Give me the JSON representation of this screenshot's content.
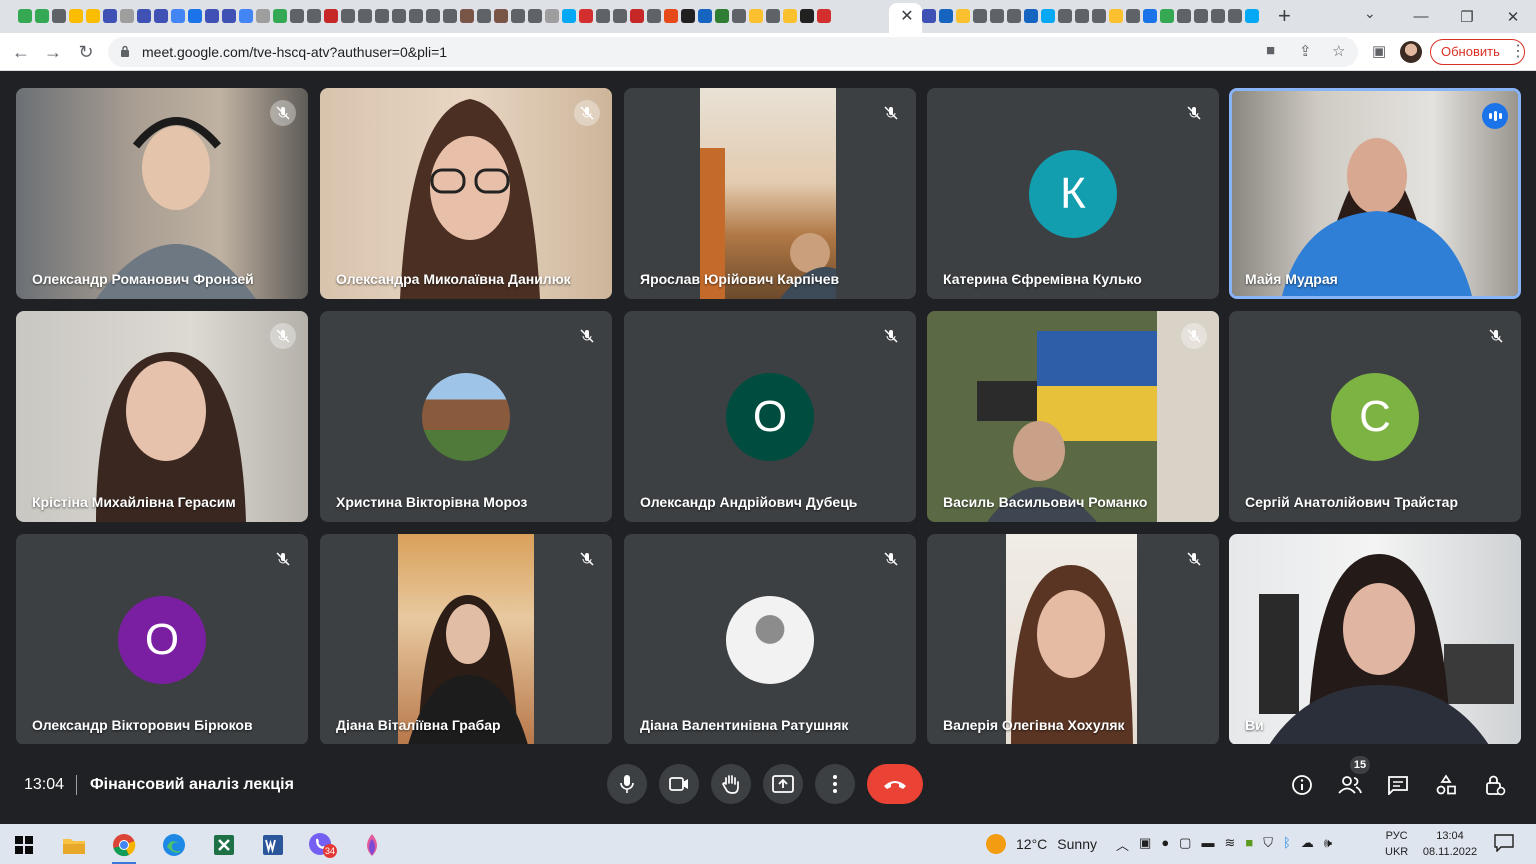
{
  "browser": {
    "url": "meet.google.com/tve-hscq-atv?authuser=0&pli=1",
    "update_label": "Обновить",
    "window_controls": [
      "minimize",
      "restore",
      "close"
    ]
  },
  "participants": [
    {
      "name": "Олександр Романович Фронзей",
      "kind": "video",
      "muted": true
    },
    {
      "name": "Олександра Миколаївна Данилюк",
      "kind": "video",
      "muted": true
    },
    {
      "name": "Ярослав Юрійович Карпічев",
      "kind": "video",
      "muted": true
    },
    {
      "name": "Катерина Єфремівна Кулько",
      "kind": "initial",
      "initial": "К",
      "color": "#129eaf",
      "muted": true
    },
    {
      "name": "Майя Мудрая",
      "kind": "video",
      "speaking": true
    },
    {
      "name": "Крістіна Михайлівна Герасим",
      "kind": "video",
      "muted": true
    },
    {
      "name": "Христина Вікторівна Мороз",
      "kind": "photo",
      "muted": true
    },
    {
      "name": "Олександр Андрійович Дубець",
      "kind": "initial",
      "initial": "О",
      "color": "#004d40",
      "muted": true
    },
    {
      "name": "Василь Васильович Романко",
      "kind": "video",
      "muted": true
    },
    {
      "name": "Сергій Анатолійович Трайстар",
      "kind": "initial",
      "initial": "С",
      "color": "#7cb342",
      "muted": true
    },
    {
      "name": "Олександр Вікторович Бірюков",
      "kind": "initial",
      "initial": "О",
      "color": "#7b1fa2",
      "muted": true
    },
    {
      "name": "Діана Віталіївна Грабар",
      "kind": "video",
      "muted": true
    },
    {
      "name": "Діана Валентинівна Ратушняк",
      "kind": "photo",
      "muted": true
    },
    {
      "name": "Валерія Олегівна Хохуляк",
      "kind": "video",
      "muted": true
    },
    {
      "name": "Ви",
      "kind": "video",
      "self": true
    }
  ],
  "bottom_bar": {
    "time": "13:04",
    "meeting_title": "Фінансовий аналіз лекція",
    "participants_count": "15",
    "controls": [
      "mic-icon",
      "camera-icon",
      "raise-hand-icon",
      "present-icon",
      "more-options-icon",
      "end-call-icon"
    ],
    "right_controls": [
      "info-icon",
      "people-icon",
      "chat-icon",
      "activities-icon",
      "host-controls-icon"
    ]
  },
  "taskbar": {
    "weather_temp": "12°C",
    "weather_text": "Sunny",
    "lang_top": "РУС",
    "lang_bottom": "UKR",
    "time": "13:04",
    "date": "08.11.2022",
    "viber_badge": "34"
  }
}
